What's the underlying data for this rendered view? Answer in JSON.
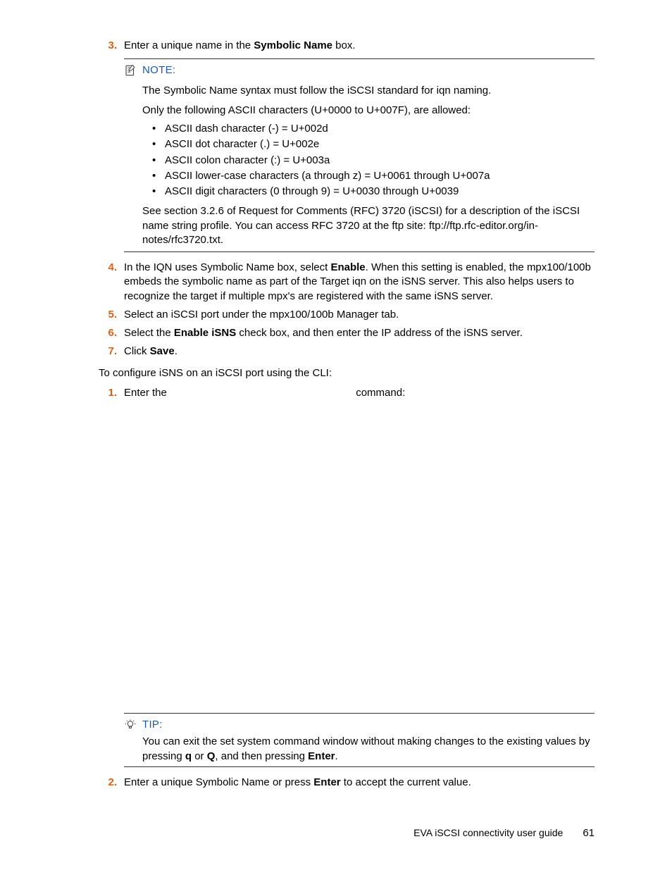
{
  "steps_a": {
    "3": {
      "num": "3.",
      "pre": "Enter a unique name in the ",
      "bold": "Symbolic Name",
      "post": " box."
    },
    "4": {
      "num": "4.",
      "pre": "In the IQN uses Symbolic Name box, select ",
      "bold": "Enable",
      "post": ".  When this setting is enabled, the mpx100/100b embeds the symbolic name as part of the Target iqn on the iSNS server.  This also helps users to recognize the target if multiple mpx's are registered with the same iSNS server."
    },
    "5": {
      "num": "5.",
      "text": "Select an iSCSI port under the mpx100/100b Manager tab."
    },
    "6": {
      "num": "6.",
      "pre": "Select the ",
      "bold": "Enable iSNS",
      "post": " check box, and then enter the IP address of the iSNS server."
    },
    "7": {
      "num": "7.",
      "pre": "Click ",
      "bold": "Save",
      "post": "."
    }
  },
  "note": {
    "label": "NOTE:",
    "p1": "The Symbolic Name syntax must follow the iSCSI standard for iqn naming.",
    "p2": "Only the following ASCII characters (U+0000 to U+007F), are allowed:",
    "bullets": [
      "ASCII dash character (-) = U+002d",
      "ASCII dot character (.)  = U+002e",
      "ASCII colon character (:) = U+003a",
      "ASCII lower-case characters (a through z) = U+0061 through U+007a",
      "ASCII digit characters (0 through 9) = U+0030 through U+0039"
    ],
    "p3": "See section 3.2.6 of Request for Comments (RFC) 3720 (iSCSI) for a description of the iSCSI name string profile.  You can access RFC 3720 at the ftp site:  ftp://ftp.rfc-editor.org/in-notes/rfc3720.txt."
  },
  "plain1": "To configure iSNS on an iSCSI port using the CLI:",
  "steps_b": {
    "1": {
      "num": "1.",
      "pre": "Enter the ",
      "post": " command:"
    },
    "2": {
      "num": "2.",
      "pre": "Enter a unique Symbolic Name or press ",
      "bold": "Enter",
      "post": " to accept the current value."
    }
  },
  "tip": {
    "label": "TIP:",
    "pre": "You can exit the set system command window without making changes to the existing values by pressing ",
    "b1": "q",
    "mid1": " or ",
    "b2": "Q",
    "mid2": ", and then pressing ",
    "b3": "Enter",
    "post": "."
  },
  "footer": {
    "title": "EVA iSCSI connectivity user guide",
    "page": "61"
  }
}
